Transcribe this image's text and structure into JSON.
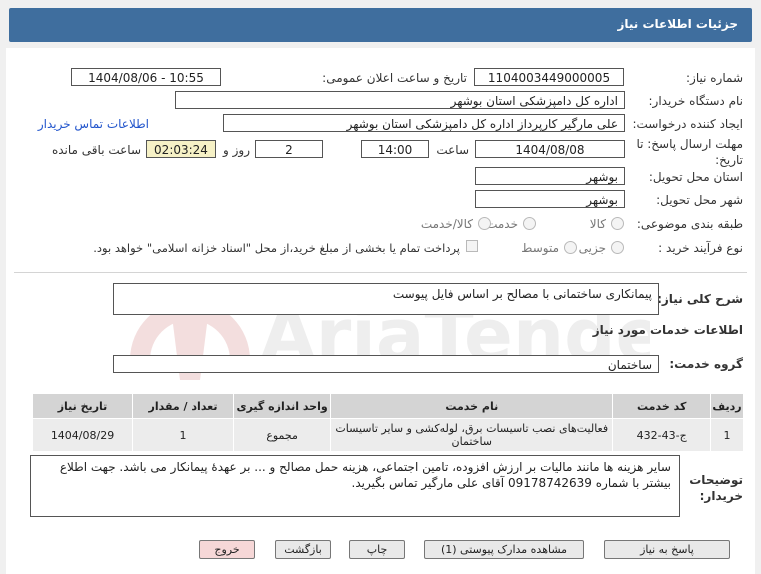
{
  "header": {
    "title": "جزئیات اطلاعات نیاز"
  },
  "form": {
    "need_number_label": "شماره نیاز:",
    "need_number": "1104003449000005",
    "announce_label": "تاریخ و ساعت اعلان عمومی:",
    "announce_value": "1404/08/06 - 10:55",
    "buyer_org_label": "نام دستگاه خریدار:",
    "buyer_org": "اداره کل دامپزشکی استان بوشهر",
    "creator_label": "ایجاد کننده درخواست:",
    "creator": "علی مارگیر کارپرداز اداره کل دامپزشکی استان بوشهر",
    "contact_link": "اطلاعات تماس خریدار",
    "deadline_label": "مهلت ارسال پاسخ: تا تاریخ:",
    "deadline_date": "1404/08/08",
    "time_label": "ساعت",
    "deadline_time": "14:00",
    "days_value": "2",
    "days_label": "روز و",
    "remaining_time": "02:03:24",
    "remaining_label": "ساعت باقی مانده",
    "province_label": "استان محل تحویل:",
    "province": "بوشهر",
    "city_label": "شهر محل تحویل:",
    "city": "بوشهر",
    "category_label": "طبقه بندی موضوعی:",
    "category_options": [
      "کالا",
      "خدمت",
      "کالا/خدمت"
    ],
    "process_label": "نوع فرآیند خرید :",
    "process_options": [
      "جزیی",
      "متوسط"
    ],
    "payment_note": "پرداخت تمام یا بخشی از مبلغ خرید،از محل \"اسناد خزانه اسلامی\" خواهد بود."
  },
  "summary": {
    "label": "شرح کلی نیاز:",
    "value": "پیمانکاری ساختمانی با مصالح بر اساس فایل پیوست"
  },
  "services": {
    "section_title": "اطلاعات خدمات مورد نیاز",
    "group_label": "گروه خدمت:",
    "group_value": "ساختمان",
    "columns": [
      "ردیف",
      "کد خدمت",
      "نام خدمت",
      "واحد اندازه گیری",
      "تعداد / مقدار",
      "تاریخ نیاز"
    ],
    "rows": [
      {
        "index": "1",
        "code": "ج-43-432",
        "name": "فعالیت‌های نصب تاسیسات برق، لوله‌کشی و سایر تاسیسات ساختمان",
        "unit": "مجموع",
        "qty": "1",
        "date": "1404/08/29"
      }
    ]
  },
  "buyer_notes": {
    "label": "توضیحات خریدار:",
    "text": "سایر هزینه ها مانند مالیات بر ارزش افزوده، تامین اجتماعی، هزینه حمل مصالح و ... بر عهدۀ پیمانکار می باشد. جهت اطلاع بیشتر با شماره 09178742639 آقای علی مارگیر تماس بگیرید."
  },
  "buttons": {
    "reply": "پاسخ به نیاز",
    "view_docs": "مشاهده مدارک پیوستی (1)",
    "print": "چاپ",
    "back": "بازگشت",
    "exit": "خروج"
  },
  "watermark": {
    "text": "AriaTender.neT"
  },
  "colors": {
    "titlebar": "#3f6e9e",
    "link": "#2255cc",
    "exit_button": "#f6d7d7",
    "remaining_box": "#f6f1c6"
  }
}
